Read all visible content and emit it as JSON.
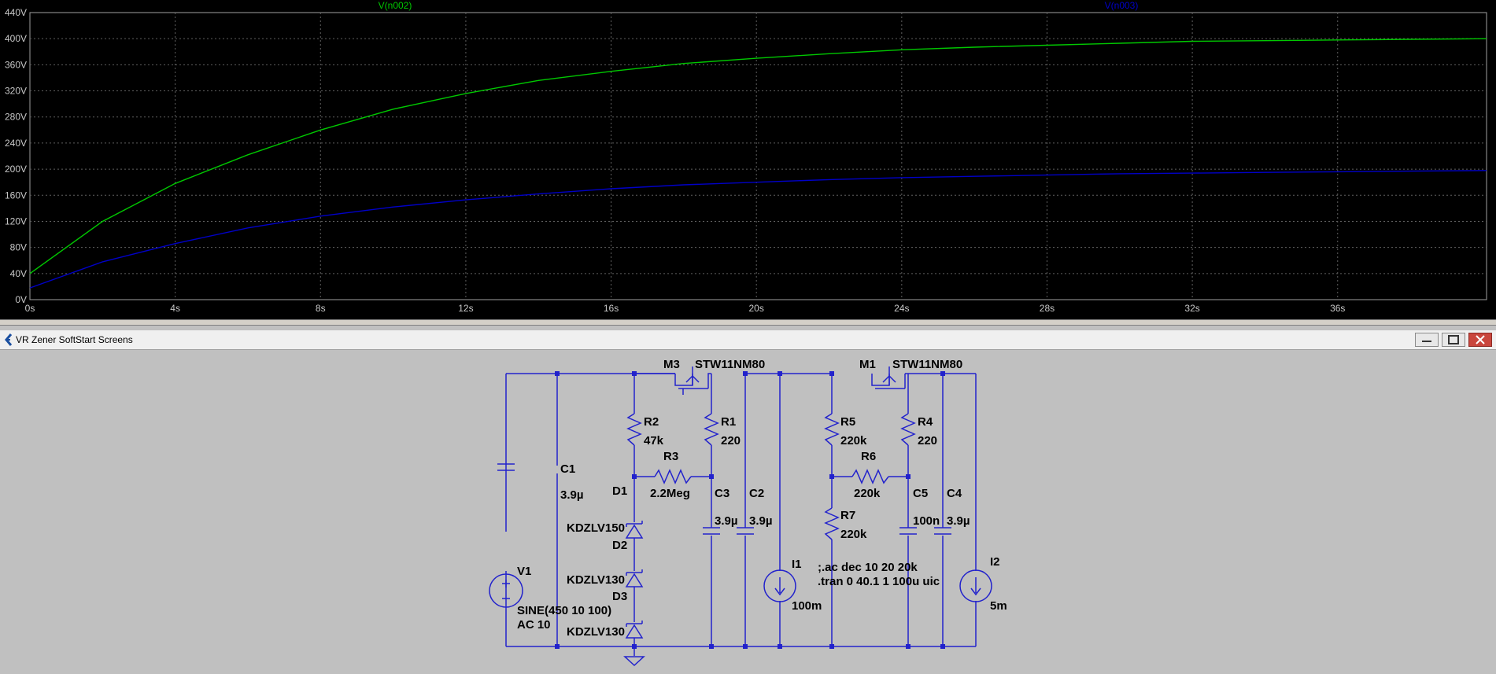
{
  "plot": {
    "traces": [
      {
        "name": "V(n002)",
        "color": "#00c800"
      },
      {
        "name": "V(n003)",
        "color": "#0000c8"
      }
    ],
    "y_ticks": [
      "0V",
      "40V",
      "80V",
      "120V",
      "160V",
      "200V",
      "240V",
      "280V",
      "320V",
      "360V",
      "400V",
      "440V"
    ],
    "x_ticks": [
      "0s",
      "4s",
      "8s",
      "12s",
      "16s",
      "20s",
      "24s",
      "28s",
      "32s",
      "36s"
    ]
  },
  "chart_data": {
    "type": "line",
    "xlim": [
      0,
      40.1
    ],
    "ylim": [
      0,
      440
    ],
    "grid": true,
    "series": [
      {
        "name": "V(n002)",
        "x": [
          0,
          2,
          4,
          6,
          8,
          10,
          12,
          14,
          16,
          18,
          20,
          22,
          24,
          26,
          28,
          30,
          32,
          34,
          36,
          38,
          40.1
        ],
        "y": [
          40,
          120,
          178,
          222,
          260,
          292,
          316,
          336,
          350,
          362,
          370,
          377,
          383,
          387,
          390,
          393,
          396,
          397,
          398,
          399,
          400
        ]
      },
      {
        "name": "V(n003)",
        "x": [
          0,
          2,
          4,
          6,
          8,
          10,
          12,
          14,
          16,
          18,
          20,
          22,
          24,
          26,
          28,
          30,
          32,
          34,
          36,
          38,
          40.1
        ],
        "y": [
          18,
          58,
          86,
          110,
          128,
          142,
          153,
          162,
          170,
          176,
          180,
          184,
          187,
          189,
          191,
          193,
          194,
          195,
          196,
          197,
          198
        ]
      }
    ]
  },
  "window": {
    "title": "VR Zener SoftStart Screens"
  },
  "schematic": {
    "labels": {
      "M3": "M3",
      "M3_part": "STW11NM80",
      "M1": "M1",
      "M1_part": "STW11NM80",
      "R2": "R2",
      "R2_val": "47k",
      "R1": "R1",
      "R1_val": "220",
      "R3": "R3",
      "R3_val": "2.2Meg",
      "R5": "R5",
      "R5_val": "220k",
      "R4": "R4",
      "R4_val": "220",
      "R6": "R6",
      "R6_val": "220k",
      "R7": "R7",
      "R7_val": "220k",
      "C1": "C1",
      "C1_val": "3.9µ",
      "C3": "C3",
      "C3_val": "3.9µ",
      "C2": "C2",
      "C2_val": "3.9µ",
      "C5": "C5",
      "C5_val": "100n",
      "C4": "C4",
      "C4_val": "3.9µ",
      "D1": "D1",
      "D1_part": "KDZLV150",
      "D2": "D2",
      "D2_part": "KDZLV130",
      "D3": "D3",
      "D3_part": "KDZLV130",
      "V1": "V1",
      "V1_val1": "SINE(450 10 100)",
      "V1_val2": "AC 10",
      "I1": "I1",
      "I1_val": "100m",
      "I2": "I2",
      "I2_val": "5m",
      "directive1": ";.ac dec 10 20 20k",
      "directive2": ".tran 0 40.1 1 100u uic"
    }
  }
}
